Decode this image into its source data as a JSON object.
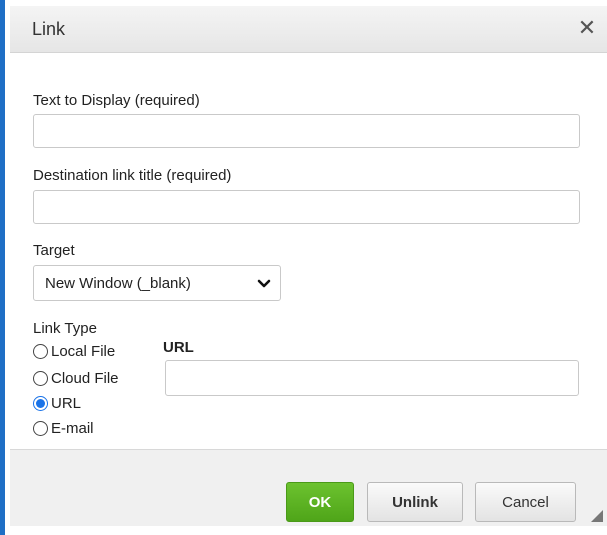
{
  "dialog": {
    "title": "Link",
    "close_symbol": "✕",
    "close_icon": "close-icon"
  },
  "fields": {
    "text_to_display": {
      "label": "Text to Display (required)",
      "value": "",
      "placeholder": ""
    },
    "destination_title": {
      "label": "Destination link title (required)",
      "value": "",
      "placeholder": ""
    },
    "target": {
      "label": "Target",
      "selected": "New Window (_blank)",
      "icon": "chevron-down-icon"
    }
  },
  "link_type": {
    "label": "Link Type",
    "options": [
      {
        "label": "Local File",
        "checked": false
      },
      {
        "label": "Cloud File",
        "checked": false
      },
      {
        "label": "URL",
        "checked": true
      },
      {
        "label": "E-mail",
        "checked": false
      }
    ]
  },
  "url": {
    "label": "URL",
    "value": "",
    "placeholder": ""
  },
  "footer": {
    "ok_label": "OK",
    "unlink_label": "Unlink",
    "cancel_label": "Cancel"
  },
  "colors": {
    "accent_bar": "#1f6fc5",
    "ok_green": "#5cb21e",
    "radio_selected": "#1a73e8"
  }
}
